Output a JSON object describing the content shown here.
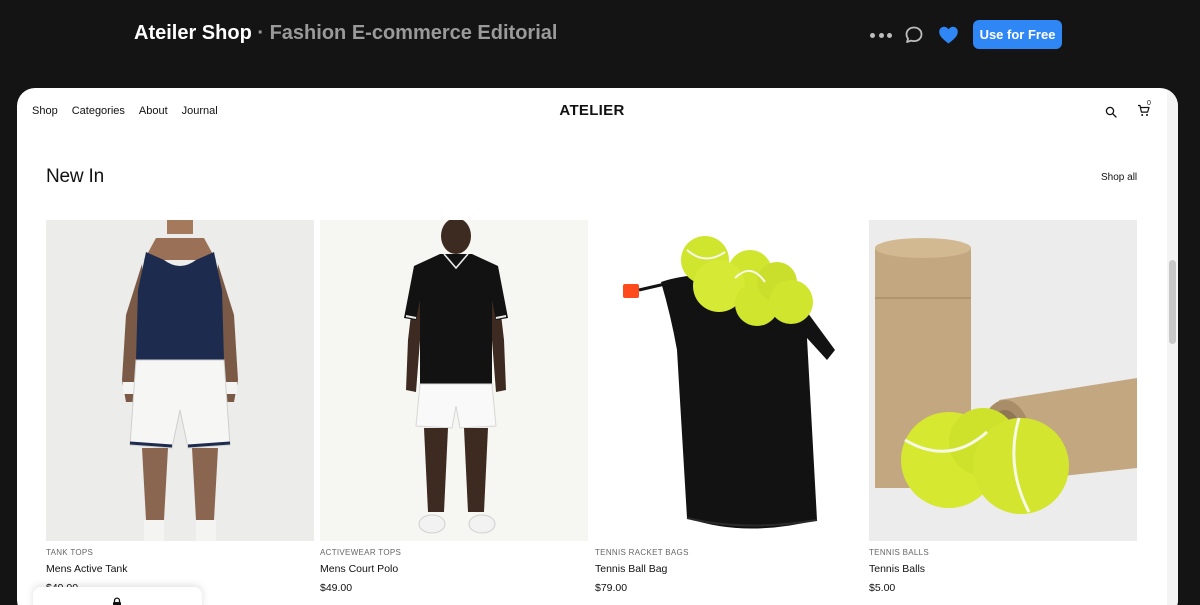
{
  "header": {
    "title": "Ateiler Shop",
    "subtitle": "Fashion E-commerce Editorial",
    "separator": "·",
    "cta_label": "Use for Free",
    "icons": [
      "more-dots-icon",
      "comment-icon",
      "heart-icon"
    ],
    "accent": "#2f86f5"
  },
  "shop": {
    "nav_links": [
      "Shop",
      "Categories",
      "About",
      "Journal"
    ],
    "brand": "ATELIER",
    "cart_count": "0",
    "section_title": "New In",
    "shop_all_label": "Shop all",
    "products": [
      {
        "category": "TANK TOPS",
        "name": "Mens Active Tank",
        "price": "$49.00"
      },
      {
        "category": "ACTIVEWEAR TOPS",
        "name": "Mens Court Polo",
        "price": "$49.00"
      },
      {
        "category": "TENNIS RACKET BAGS",
        "name": "Tennis Ball Bag",
        "price": "$79.00"
      },
      {
        "category": "TENNIS BALLS",
        "name": "Tennis Balls",
        "price": "$5.00"
      }
    ]
  }
}
